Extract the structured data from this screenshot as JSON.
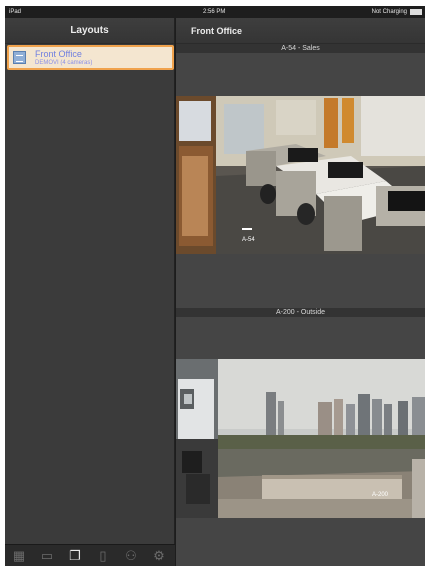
{
  "status_bar": {
    "device": "iPad",
    "time": "2:56 PM",
    "charging": "Not Charging"
  },
  "sidebar": {
    "title": "Layouts",
    "items": [
      {
        "title": "Front Office",
        "subtitle": "DEMOVI (4 cameras)",
        "selected": true,
        "icon": "layout-icon"
      }
    ]
  },
  "tab_bar": [
    {
      "icon": "layouts-grid-icon",
      "glyph": "▦",
      "active": false
    },
    {
      "icon": "camera-icon",
      "glyph": "▭",
      "active": false
    },
    {
      "icon": "stacked-pages-icon",
      "glyph": "❐",
      "active": true
    },
    {
      "icon": "document-icon",
      "glyph": "▯",
      "active": false
    },
    {
      "icon": "users-icon",
      "glyph": "⚇",
      "active": false
    },
    {
      "icon": "settings-gear-icon",
      "glyph": "⚙",
      "active": false
    }
  ],
  "main": {
    "title": "Front Office",
    "cameras": [
      {
        "label": "A-54 - Sales",
        "overlay": "A-54"
      },
      {
        "label": "A-200 - Outside",
        "overlay": "A-200"
      }
    ]
  },
  "colors": {
    "selection_border": "#f0a24c",
    "selection_bg": "#f4e6d0",
    "item_text": "#6f7fe0"
  }
}
